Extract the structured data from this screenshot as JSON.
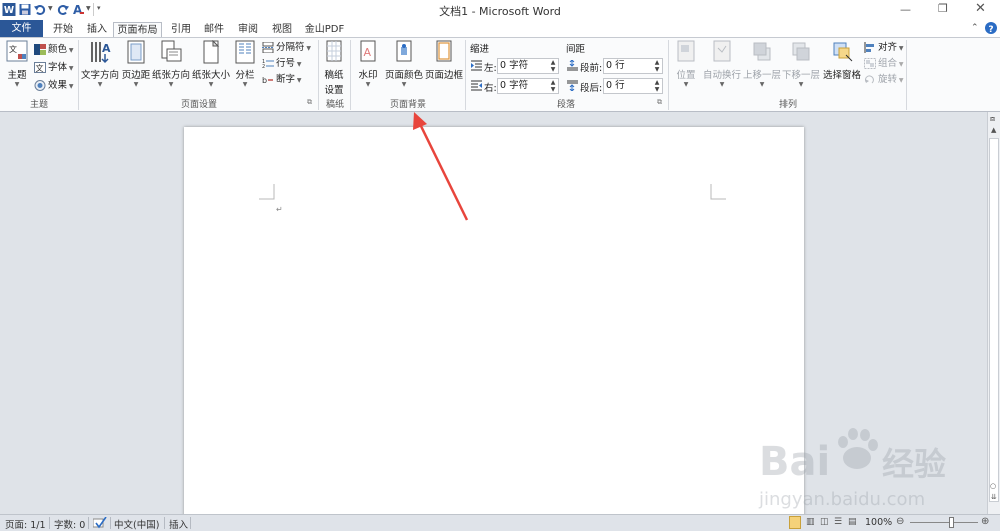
{
  "window": {
    "title": "文档1 - Microsoft Word",
    "controls": {
      "minimize": "minimize-icon",
      "restore": "restore-icon",
      "close": "close-icon"
    }
  },
  "quick_access": [
    "word-logo-icon",
    "save-icon",
    "undo-icon",
    "redo-icon",
    "format-painter-icon",
    "customize-icon"
  ],
  "tabs": [
    "文件",
    "开始",
    "插入",
    "页面布局",
    "引用",
    "邮件",
    "审阅",
    "视图",
    "金山PDF"
  ],
  "active_tab": "页面布局",
  "ribbon": {
    "theme": {
      "label": "主题",
      "big": "主题",
      "colors": "颜色",
      "fonts": "字体",
      "effects": "效果"
    },
    "page_setup": {
      "label": "页面设置",
      "text_direction": "文字方向",
      "margins": "页边距",
      "orientation": "纸张方向",
      "size": "纸张大小",
      "columns": "分栏",
      "breaks": "分隔符",
      "line_numbers": "行号",
      "hyphenation": "断字"
    },
    "draft": {
      "label": "稿纸",
      "btn_line1": "稿纸",
      "btn_line2": "设置"
    },
    "page_background": {
      "label": "页面背景",
      "watermark": "水印",
      "page_color": "页面颜色",
      "page_borders": "页面边框"
    },
    "paragraph": {
      "label": "段落",
      "indent_title": "缩进",
      "spacing_title": "间距",
      "left_label": "左:",
      "left_value": "0 字符",
      "right_label": "右:",
      "right_value": "0 字符",
      "before_label": "段前:",
      "before_value": "0 行",
      "after_label": "段后:",
      "after_value": "0 行"
    },
    "arrange": {
      "label": "排列",
      "position": "位置",
      "wrap_text": "自动换行",
      "bring_forward": "上移一层",
      "send_backward": "下移一层",
      "selection_pane": "选择窗格",
      "align": "对齐",
      "group": "组合",
      "rotate": "旋转"
    }
  },
  "status": {
    "page": "页面: 1/1",
    "words": "字数: 0",
    "language": "中文(中国)",
    "mode": "插入",
    "zoom": "100%",
    "zoom_level": 1.0
  },
  "watermark": {
    "brand": "Bai",
    "brand2": "du",
    "brand_cn": "经验",
    "url": "jingyan.baidu.com"
  },
  "colors": {
    "file_tab": "#2b5797",
    "arrow": "#e8453c"
  }
}
